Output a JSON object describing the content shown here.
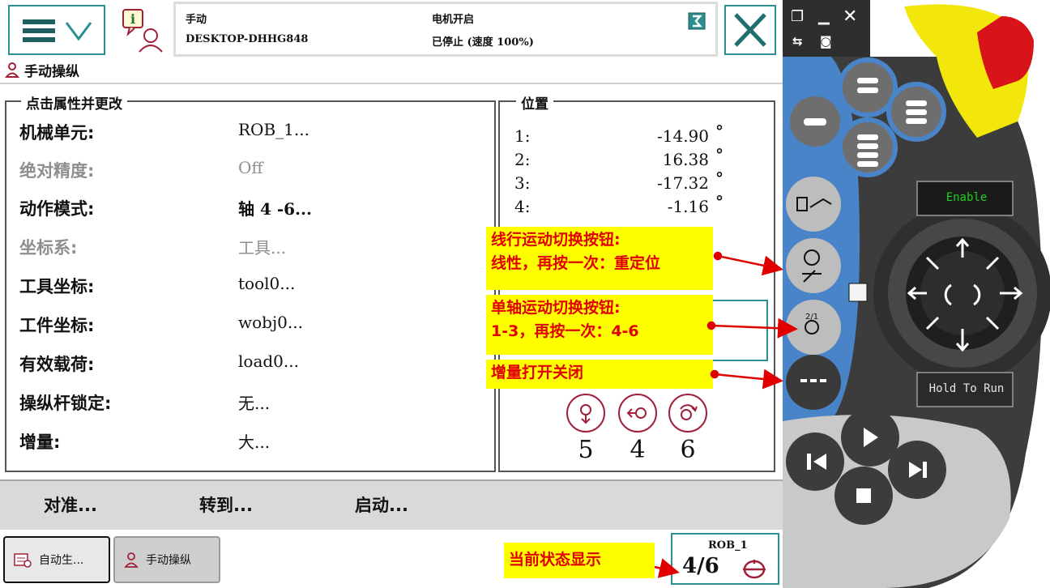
{
  "status_bar": {
    "mode": "手动",
    "controller": "DESKTOP-DHHG848",
    "motor_state": "电机开启",
    "run_state": "已停止 (速度 100%)"
  },
  "page": {
    "title": "手动操纵"
  },
  "properties": {
    "legend": "点击属性并更改",
    "rows": [
      {
        "label": "机械单元:",
        "value": "ROB_1..."
      },
      {
        "label": "绝对精度:",
        "value": "Off"
      },
      {
        "label": "动作模式:",
        "value": "轴 4 -6..."
      },
      {
        "label": "坐标系:",
        "value": "工具..."
      },
      {
        "label": "工具坐标:",
        "value": "tool0..."
      },
      {
        "label": "工件坐标:",
        "value": "wobj0..."
      },
      {
        "label": "有效载荷:",
        "value": "load0..."
      },
      {
        "label": "操纵杆锁定:",
        "value": "无..."
      },
      {
        "label": "增量:",
        "value": "大..."
      }
    ]
  },
  "position": {
    "legend": "位置",
    "unit": "°",
    "rows": [
      {
        "index": "1:",
        "value": "-14.90"
      },
      {
        "index": "2:",
        "value": "16.38"
      },
      {
        "index": "3:",
        "value": "-17.32"
      },
      {
        "index": "4:",
        "value": "-1.16"
      }
    ],
    "axes": [
      "5",
      "4",
      "6"
    ]
  },
  "commands": {
    "align": "对准...",
    "goto": "转到...",
    "start": "启动..."
  },
  "taskbar": {
    "auto": "自动生...",
    "manual": "手动操纵"
  },
  "quickset": {
    "unit": "ROB_1",
    "axis_group": "4/6"
  },
  "annotations": {
    "linear_line1": "线行运动切换按钮:",
    "linear_line2": "线性，再按一次：重定位",
    "axis_line1": "单轴运动切换按钮:",
    "axis_line2": "1-3，再按一次：4-6",
    "increment": "增量打开关闭",
    "current_state": "当前状态显示"
  },
  "device": {
    "enable_label": "Enable",
    "hold_label": "Hold To Run"
  },
  "colors": {
    "accent": "#2b8f8f",
    "note_bg": "#ffff00",
    "note_text": "#e00000",
    "arrow": "#e00000",
    "device_blue": "#4a84c8",
    "device_body": "#3c3c3c"
  }
}
